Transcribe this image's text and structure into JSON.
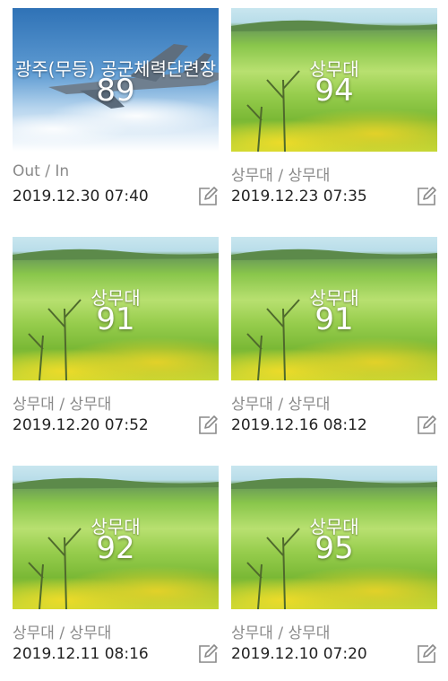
{
  "cards": [
    {
      "title": "광주(무등) 공군체력단련장",
      "score": "89",
      "course": "Out / In",
      "date": "2019.12.30 07:40",
      "edit_icon": "edit-icon",
      "bg": "sky"
    },
    {
      "title": "상무대",
      "score": "94",
      "course": "상무대 / 상무대",
      "date": "2019.12.23 07:35",
      "edit_icon": "edit-icon",
      "bg": "golf"
    },
    {
      "title": "상무대",
      "score": "91",
      "course": "상무대 / 상무대",
      "date": "2019.12.20 07:52",
      "edit_icon": "edit-icon",
      "bg": "golf"
    },
    {
      "title": "상무대",
      "score": "91",
      "course": "상무대 / 상무대",
      "date": "2019.12.16 08:12",
      "edit_icon": "edit-icon",
      "bg": "golf"
    },
    {
      "title": "상무대",
      "score": "92",
      "course": "상무대 / 상무대",
      "date": "2019.12.11 08:16",
      "edit_icon": "edit-icon",
      "bg": "golf"
    },
    {
      "title": "상무대",
      "score": "95",
      "course": "상무대 / 상무대",
      "date": "2019.12.10 07:20",
      "edit_icon": "edit-icon",
      "bg": "golf"
    }
  ],
  "colors": {
    "text_primary": "#222222",
    "text_secondary": "#8a8a8a",
    "icon": "#8a8a8a"
  }
}
